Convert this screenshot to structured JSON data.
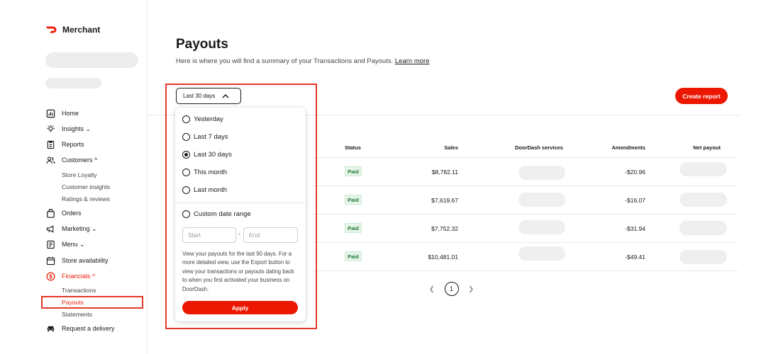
{
  "brand": {
    "name": "Merchant",
    "color": "#eb1700"
  },
  "sidebar": {
    "items": [
      {
        "label": "Home",
        "icon": "home-icon"
      },
      {
        "label": "Insights ⌄",
        "icon": "lightbulb-icon"
      },
      {
        "label": "Reports",
        "icon": "report-icon"
      },
      {
        "label": "Customers ^",
        "icon": "customers-icon"
      },
      {
        "label": "Orders",
        "icon": "bag-icon"
      },
      {
        "label": "Marketing ⌄",
        "icon": "megaphone-icon"
      },
      {
        "label": "Menu ⌄",
        "icon": "menu-book-icon"
      },
      {
        "label": "Store availability",
        "icon": "calendar-icon"
      },
      {
        "label": "Financials ^",
        "icon": "dollar-icon"
      },
      {
        "label": "Request a delivery",
        "icon": "car-icon"
      }
    ],
    "customers_sub": [
      "Store Loyalty",
      "Customer insights",
      "Ratings & reviews"
    ],
    "financials_sub": [
      "Transactions",
      "Payouts",
      "Statements"
    ]
  },
  "main": {
    "title": "Payouts",
    "subtitle": "Here is where you will find a summary of your Transactions and Payouts.",
    "learn_more": "Learn more",
    "create_report": "Create report"
  },
  "filter": {
    "selected": "Last 30 days",
    "options": [
      "Yesterday",
      "Last 7 days",
      "Last 30 days",
      "This month",
      "Last month"
    ],
    "custom_label": "Custom date range",
    "start_placeholder": "Start",
    "end_placeholder": "End",
    "note": "View your payouts for the last 90 days. For a more detailed view, use the Export button to view your transactions or payouts dating back to when you first activated your business on DoorDash.",
    "apply": "Apply"
  },
  "table": {
    "columns": [
      "Status",
      "Sales",
      "DoorDash services",
      "Amendments",
      "Net payout"
    ],
    "rows": [
      {
        "status": "Paid",
        "sales": "$8,782.11",
        "amendments": "-$20.96"
      },
      {
        "status": "Paid",
        "sales": "$7,619.67",
        "amendments": "-$16.07"
      },
      {
        "status": "Paid",
        "sales": "$7,752.32",
        "amendments": "-$31.94"
      },
      {
        "status": "Paid",
        "sales": "$10,481.01",
        "amendments": "-$49.41"
      }
    ]
  },
  "pagination": {
    "current": "1"
  }
}
